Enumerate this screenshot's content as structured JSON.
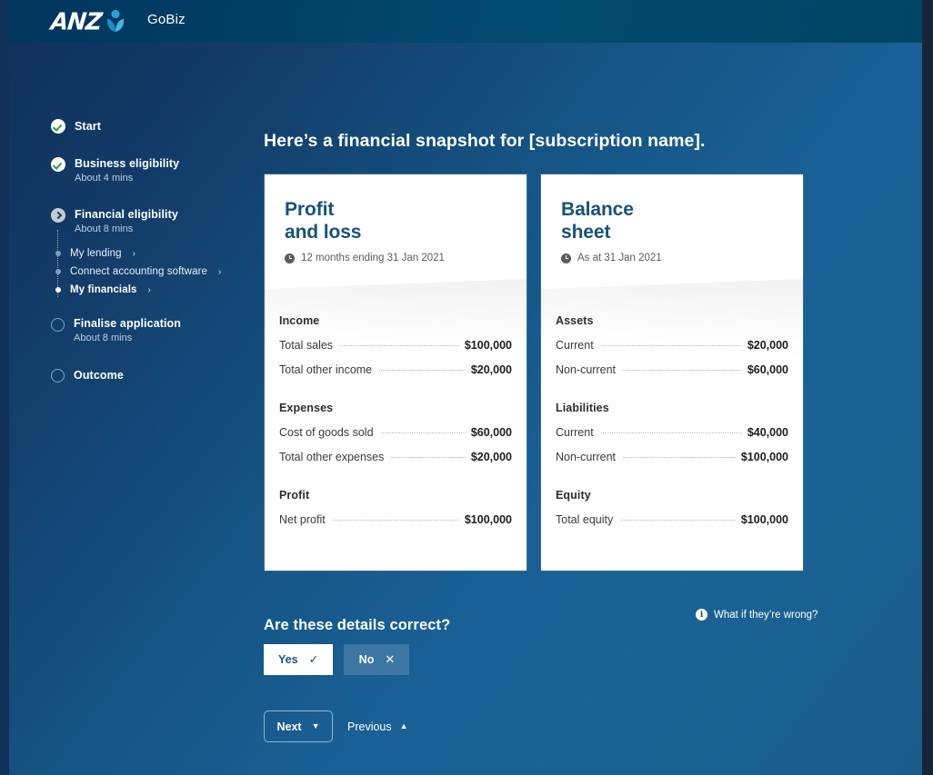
{
  "header": {
    "brand_text": "ANZ",
    "product_name": "GoBiz"
  },
  "sidebar": {
    "steps": [
      {
        "label": "Start",
        "sub": "",
        "state": "done"
      },
      {
        "label": "Business eligibility",
        "sub": "About 4 mins",
        "state": "done"
      },
      {
        "label": "Financial eligibility",
        "sub": "About 8 mins",
        "state": "current"
      },
      {
        "label": "Finalise application",
        "sub": "About 8 mins",
        "state": "pending"
      },
      {
        "label": "Outcome",
        "sub": "",
        "state": "pending"
      }
    ],
    "substeps": [
      {
        "label": "My lending",
        "chevron": "›",
        "active": false
      },
      {
        "label": "Connect accounting software",
        "chevron": "›",
        "active": false
      },
      {
        "label": "My financials",
        "chevron": "›",
        "active": true
      }
    ]
  },
  "main": {
    "title": "Here’s a financial snapshot for [subscription name].",
    "cards": [
      {
        "title_line1": "Profit",
        "title_line2": "and loss",
        "date": "12 months ending 31 Jan 2021",
        "sections": [
          {
            "heading": "Income",
            "rows": [
              {
                "label": "Total sales",
                "value": "$100,000"
              },
              {
                "label": "Total other income",
                "value": "$20,000"
              }
            ]
          },
          {
            "heading": "Expenses",
            "rows": [
              {
                "label": "Cost of goods sold",
                "value": "$60,000"
              },
              {
                "label": "Total other expenses",
                "value": "$20,000"
              }
            ]
          },
          {
            "heading": "Profit",
            "rows": [
              {
                "label": "Net profit",
                "value": "$100,000"
              }
            ]
          }
        ]
      },
      {
        "title_line1": "Balance",
        "title_line2": "sheet",
        "date": "As at 31 Jan 2021",
        "sections": [
          {
            "heading": "Assets",
            "rows": [
              {
                "label": "Current",
                "value": "$20,000"
              },
              {
                "label": "Non-current",
                "value": "$60,000"
              }
            ]
          },
          {
            "heading": "Liabilities",
            "rows": [
              {
                "label": "Current",
                "value": "$40,000"
              },
              {
                "label": "Non-current",
                "value": "$100,000"
              }
            ]
          },
          {
            "heading": "Equity",
            "rows": [
              {
                "label": "Total equity",
                "value": "$100,000"
              }
            ]
          }
        ]
      }
    ]
  },
  "confirm": {
    "question": "Are these details correct?",
    "help_label": "What if they’re wrong?",
    "info_glyph": "i",
    "yes_label": "Yes",
    "yes_glyph": "✓",
    "no_label": "No",
    "no_glyph": "✕"
  },
  "nav": {
    "next_label": "Next",
    "next_chevron": "▼",
    "previous_label": "Previous",
    "previous_chevron": "▲"
  },
  "colors": {
    "brand_navy": "#10305a",
    "brand_blue": "#1a6096",
    "header_navy": "#014a70",
    "card_title": "#17527a",
    "accent_white": "#ffffff",
    "check_green": "#2e9e3e"
  }
}
